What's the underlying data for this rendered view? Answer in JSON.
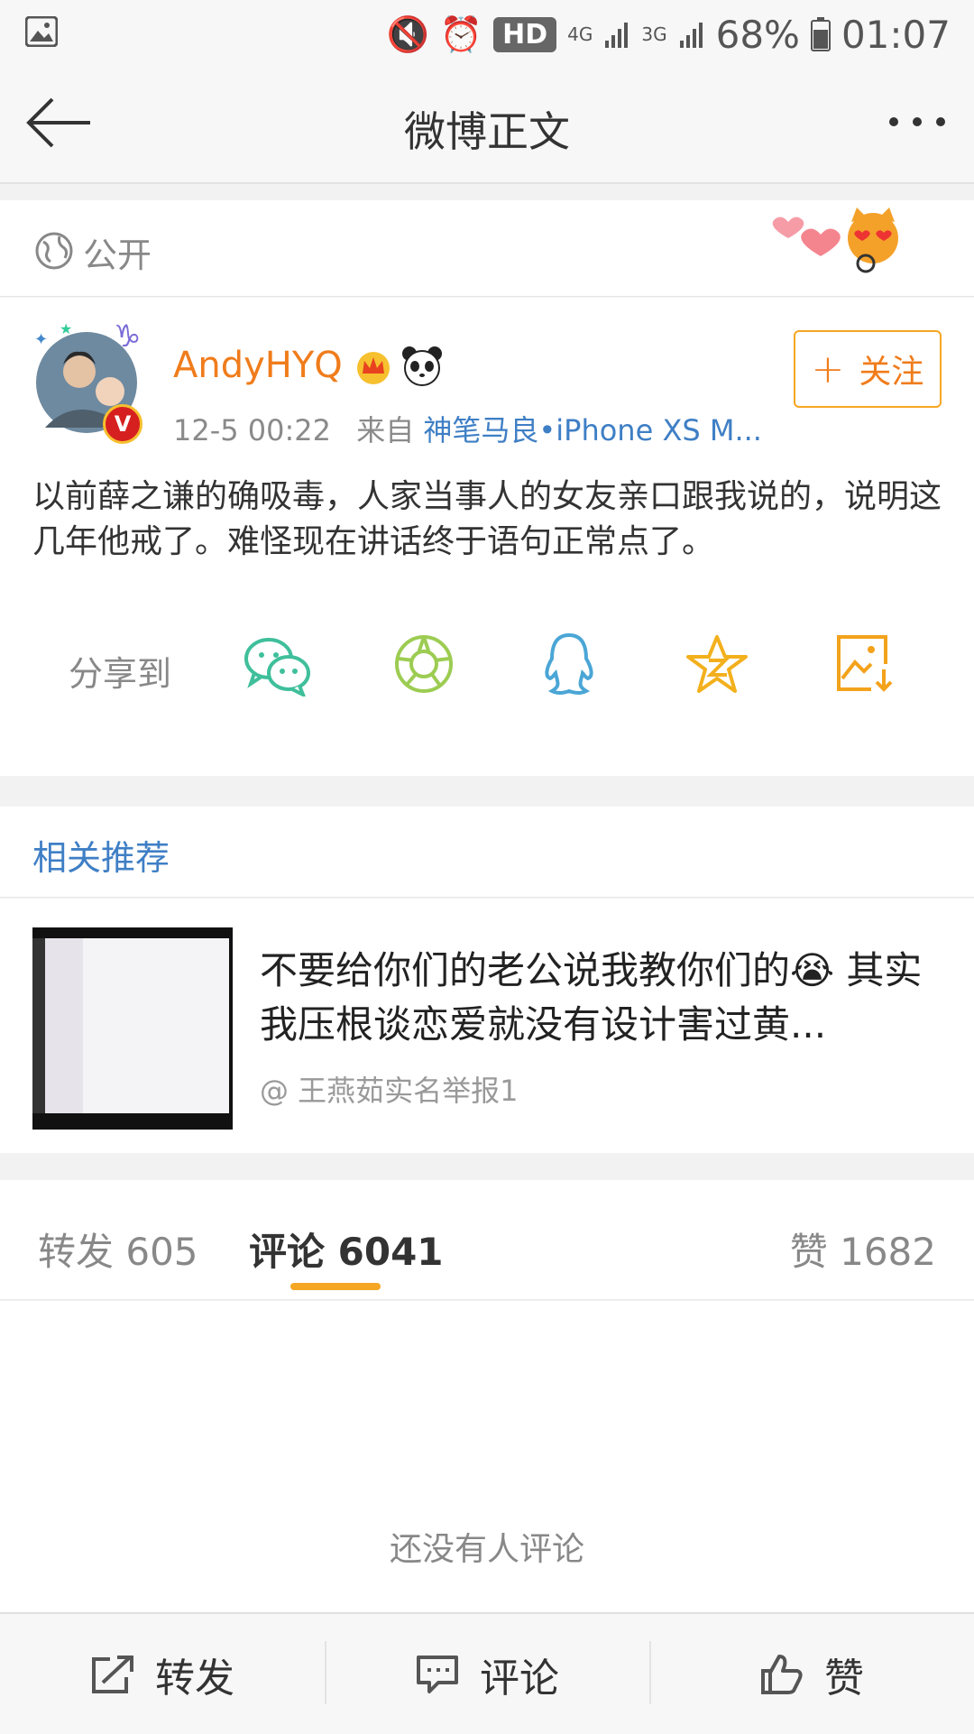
{
  "status_bar": {
    "battery": "68%",
    "time": "01:07",
    "hd": "HD",
    "net1": "4G",
    "net2": "3G"
  },
  "nav": {
    "title": "微博正文"
  },
  "visibility": {
    "label": "公开"
  },
  "post": {
    "username": "AndyHYQ",
    "time": "12-5 00:22",
    "from_label": "来自",
    "source": "神笔马良•iPhone XS M...",
    "follow_label": "关注",
    "content": "以前薛之谦的确吸毒，人家当事人的女友亲口跟我说的，说明这几年他戒了。难怪现在讲话终于语句正常点了。",
    "share_label": "分享到"
  },
  "related": {
    "heading": "相关推荐",
    "title": "不要给你们的老公说我教你们的😭 其实我压根谈恋爱就没有设计害过黄...",
    "author": "@ 王燕茹实名举报1"
  },
  "tabs": {
    "repost": "转发 605",
    "comment": "评论 6041",
    "like": "赞 1682"
  },
  "empty_text": "还没有人评论",
  "bottom": {
    "repost": "转发",
    "comment": "评论",
    "like": "赞"
  },
  "colors": {
    "accent": "#f07c1b",
    "link": "#3f7fc5",
    "wechat": "#3fbf9b",
    "moments": "#9ccc52",
    "qq": "#4aa6d6",
    "qzone": "#f3b01d",
    "save": "#f3a21b"
  }
}
